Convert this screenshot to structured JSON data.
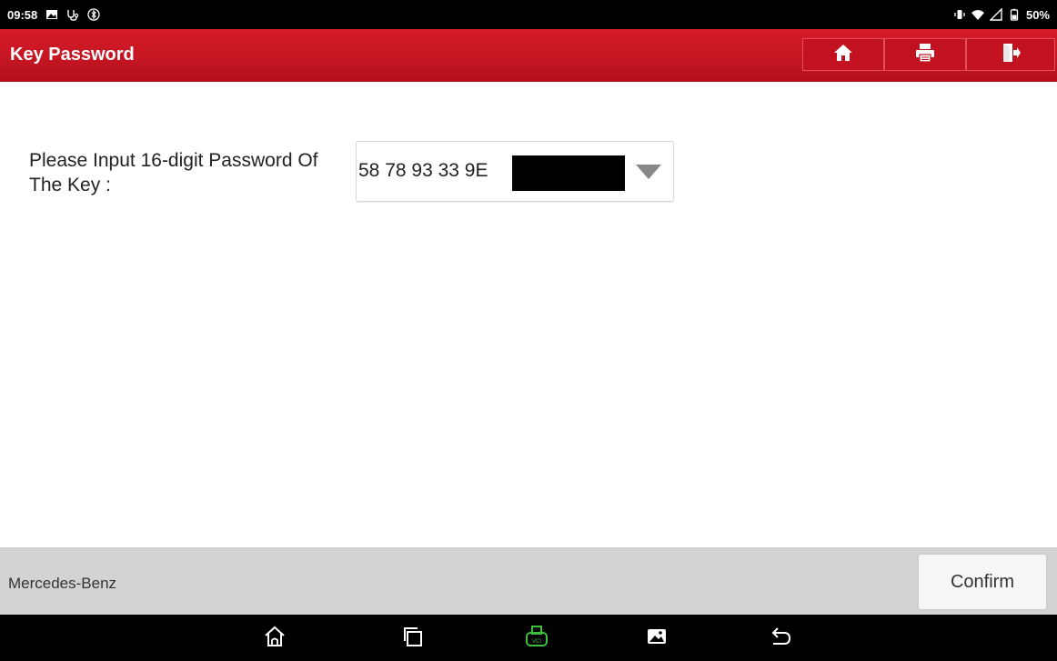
{
  "status_bar": {
    "time": "09:58",
    "battery": "50%",
    "left_icons": [
      "image-notification-icon",
      "diagnostic-icon",
      "bluetooth-icon"
    ],
    "right_icons": [
      "vibrate-icon",
      "wifi-icon",
      "signal-icon",
      "battery-icon"
    ]
  },
  "title_bar": {
    "title": "Key Password",
    "buttons": [
      "home-icon",
      "print-icon",
      "exit-icon"
    ]
  },
  "form": {
    "label": "Please Input 16-digit Password Of The Key :",
    "value": "58 78 93 33 9E",
    "redacted": true
  },
  "footer": {
    "brand": "Mercedes-Benz",
    "confirm_label": "Confirm"
  },
  "nav_bar": {
    "items": [
      "home-icon",
      "recent-apps-icon",
      "vci-icon",
      "gallery-icon",
      "back-icon"
    ],
    "vci_color": "#3cbf3c"
  },
  "colors": {
    "title_bar": "#c8141f",
    "footer": "#d3d3d3",
    "status_bar": "#000000"
  }
}
